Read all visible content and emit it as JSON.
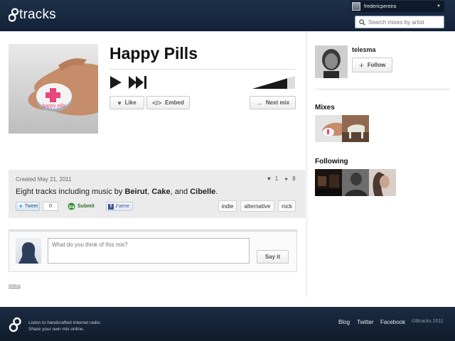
{
  "header": {
    "logo_text": "tracks",
    "user_name": "fredericpereira",
    "search_placeholder": "Search mixes by artist"
  },
  "mix": {
    "title": "Happy Pills",
    "cover_text": "happy pills",
    "like_label": "Like",
    "embed_label": "Embed",
    "next_label": "Next mix",
    "created": "Created May 21, 2011",
    "likes_count": "1",
    "plays_count": "8",
    "description": {
      "prefix": "Eight tracks including music by ",
      "artist1": "Beirut",
      "sep1": ", ",
      "artist2": "Cake",
      "sep2": ", and ",
      "artist3": "Cibelle",
      "suffix": "."
    },
    "share": {
      "tweet_label": "Tweet",
      "tweet_count": "0",
      "submit_label": "Submit",
      "jaime_label": "J'aime"
    },
    "tags": [
      "indie",
      "alternative",
      "rock"
    ]
  },
  "comment": {
    "placeholder": "What do you think of this mix?",
    "submit_label": "Say it"
  },
  "debug_label": "debug",
  "sidebar": {
    "artist_name": "telesma",
    "follow_label": "Follow",
    "mixes_heading": "Mixes",
    "following_heading": "Following"
  },
  "footer": {
    "tagline_line1": "Listen to handcrafted internet radio.",
    "tagline_line2": "Share your own mix online.",
    "links": [
      "Blog",
      "Twitter",
      "Facebook"
    ],
    "copyright": "©8tracks 2011"
  },
  "colors": {
    "header_bg": "#1d3049",
    "footer_bg": "#1a2b42",
    "panel_bg": "#ebebeb",
    "accent_pink": "#e8467c"
  }
}
